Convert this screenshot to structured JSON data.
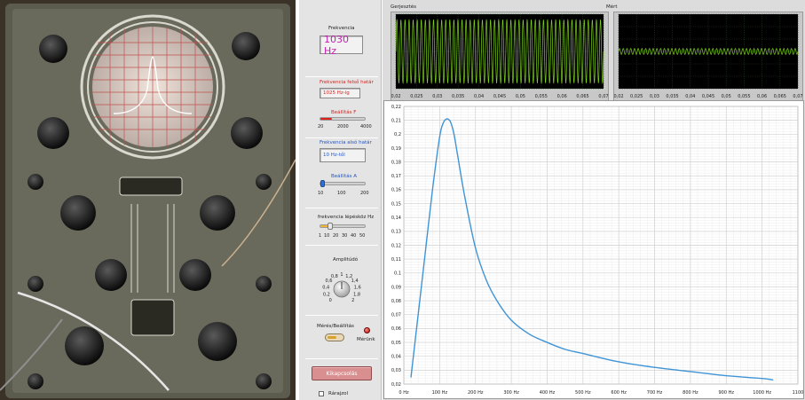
{
  "panel": {
    "freq_title": "Frekvencia",
    "freq_display": "1030 Hz",
    "upper_limit_label": "Frekvencia felső határ",
    "upper_limit_value": "1025 Hz-ig",
    "setting_f_label": "Beállítás F",
    "setting_f_ticks": [
      "20",
      "2000",
      "4000"
    ],
    "setting_f_fraction": 0.25,
    "lower_limit_label": "Frekvencia alsó határ",
    "lower_limit_value": "10 Hz-től",
    "setting_a_label": "Beállítás A",
    "setting_a_ticks": [
      "10",
      "100",
      "200"
    ],
    "setting_a_fraction": 0.03,
    "step_label": "frekvencia lépésköz Hz",
    "step_ticks": [
      "1",
      "10",
      "20",
      "30",
      "40",
      "50"
    ],
    "step_fraction": 0.22,
    "amplitude_label": "Amplitúdó",
    "amplitude_ticks": [
      "0",
      "0,2",
      "0,4",
      "0,6",
      "0,8",
      "1",
      "1,2",
      "1,4",
      "1,6",
      "1,8",
      "2"
    ],
    "amplitude_value": 1,
    "measure_label": "Mérés/Beállítás",
    "measuring_label": "Mérünk",
    "stop_button": "Kikapcsolás",
    "draw_checkbox_label": "Rárajzol"
  },
  "excitation": {
    "title": "Gerjesztés",
    "x_ticks": [
      "0,02",
      "0,025",
      "0,03",
      "0,035",
      "0,04",
      "0,045",
      "0,05",
      "0,055",
      "0,06",
      "0,065",
      "0,07"
    ]
  },
  "measured": {
    "title": "Mért",
    "x_ticks": [
      "0,02",
      "0,025",
      "0,03",
      "0,035",
      "0,04",
      "0,045",
      "0,05",
      "0,055",
      "0,06",
      "0,065",
      "0,07"
    ]
  },
  "colors": {
    "wave_green": "#7fd11b",
    "curve_blue": "#3f94d6",
    "display_magenta": "#c21fb0",
    "label_red": "#d8241f",
    "label_blue": "#2255c8"
  },
  "chart_data": {
    "type": "line",
    "xlim": [
      0,
      1100
    ],
    "ylim": [
      0.02,
      0.22
    ],
    "x_ticks": [
      "0 Hz",
      "100 Hz",
      "200 Hz",
      "300 Hz",
      "400 Hz",
      "500 Hz",
      "600 Hz",
      "700 Hz",
      "800 Hz",
      "900 Hz",
      "1000 Hz",
      "1100"
    ],
    "y_ticks": [
      "0,02",
      "0,03",
      "0,04",
      "0,05",
      "0,06",
      "0,07",
      "0,08",
      "0,09",
      "0,1",
      "0,11",
      "0,12",
      "0,13",
      "0,14",
      "0,15",
      "0,16",
      "0,17",
      "0,18",
      "0,19",
      "0,2",
      "0,21",
      "0,22"
    ],
    "grid": true,
    "series": [
      {
        "x": [
          20,
          40,
          60,
          80,
          100,
          110,
          120,
          130,
          140,
          150,
          170,
          200,
          230,
          260,
          300,
          350,
          400,
          450,
          500,
          600,
          700,
          800,
          900,
          1000,
          1030
        ],
        "values": [
          0.025,
          0.07,
          0.115,
          0.16,
          0.198,
          0.208,
          0.211,
          0.209,
          0.2,
          0.185,
          0.155,
          0.118,
          0.095,
          0.08,
          0.066,
          0.056,
          0.05,
          0.045,
          0.042,
          0.036,
          0.032,
          0.029,
          0.026,
          0.024,
          0.023
        ]
      }
    ]
  }
}
